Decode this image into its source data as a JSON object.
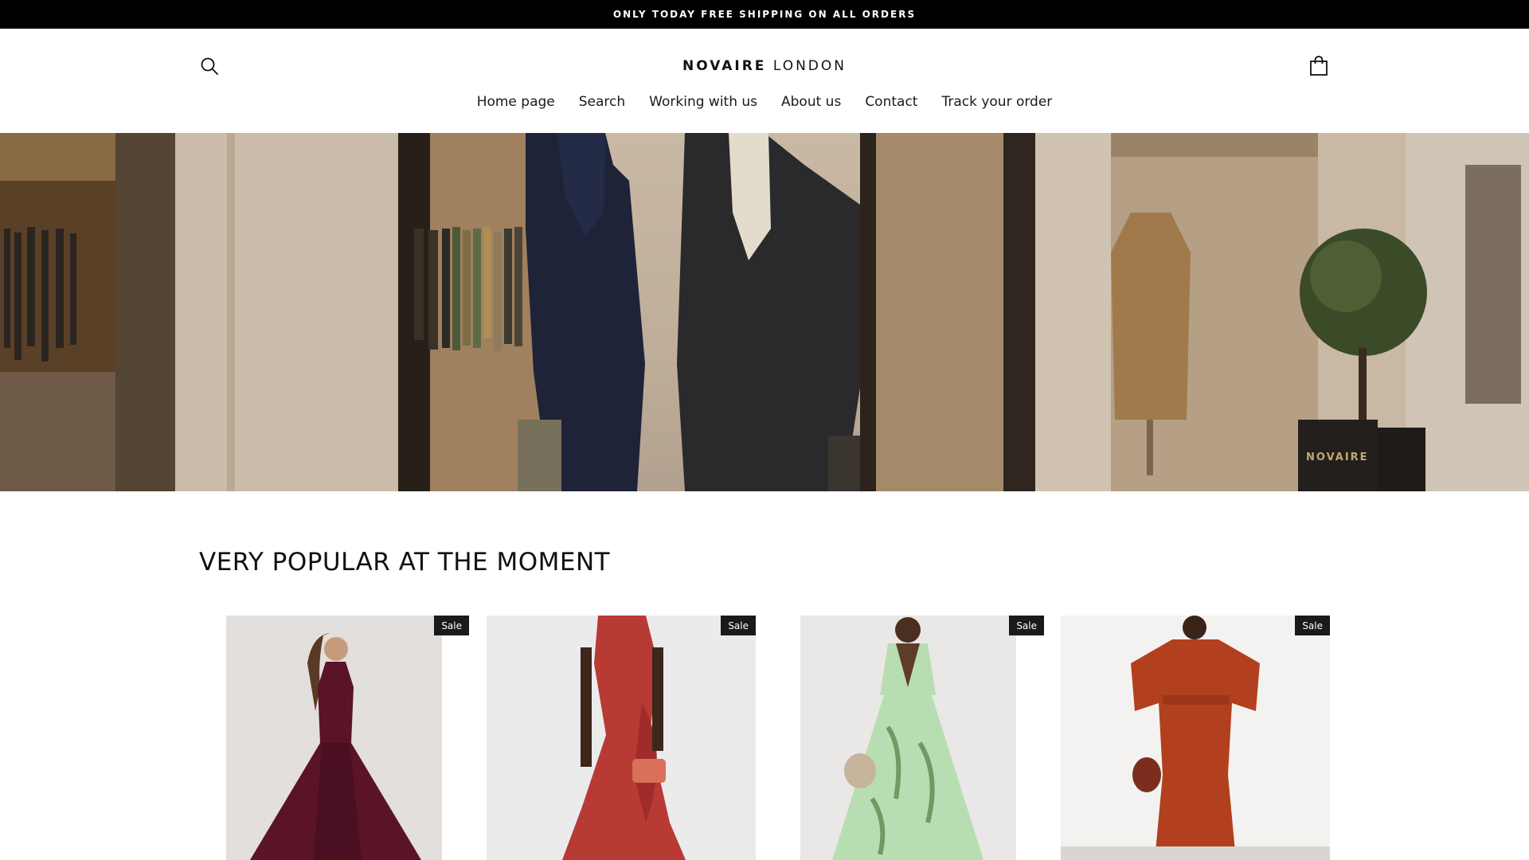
{
  "announcement": {
    "text": "ONLY TODAY FREE SHIPPING ON ALL ORDERS"
  },
  "header": {
    "logo_bold": "NOVAIRE",
    "logo_light": " LONDON",
    "search_icon": "search-icon",
    "cart_icon": "shopping-bag-icon"
  },
  "nav": {
    "items": [
      {
        "label": "Home page"
      },
      {
        "label": "Search"
      },
      {
        "label": "Working with us"
      },
      {
        "label": "About us"
      },
      {
        "label": "Contact"
      },
      {
        "label": "Track your order"
      }
    ]
  },
  "hero": {
    "storefront_sign": "NOVAIRE"
  },
  "popular": {
    "title": "VERY POPULAR AT THE MOMENT",
    "products": [
      {
        "badge": "Sale",
        "dress_color": "#5a1327"
      },
      {
        "badge": "Sale",
        "dress_color": "#b83a34"
      },
      {
        "badge": "Sale",
        "dress_color": "#b9ddb2"
      },
      {
        "badge": "Sale",
        "dress_color": "#b2401f"
      }
    ]
  },
  "colors": {
    "announcement_bg": "#000000",
    "sale_badge_bg": "#1a1a1a"
  }
}
